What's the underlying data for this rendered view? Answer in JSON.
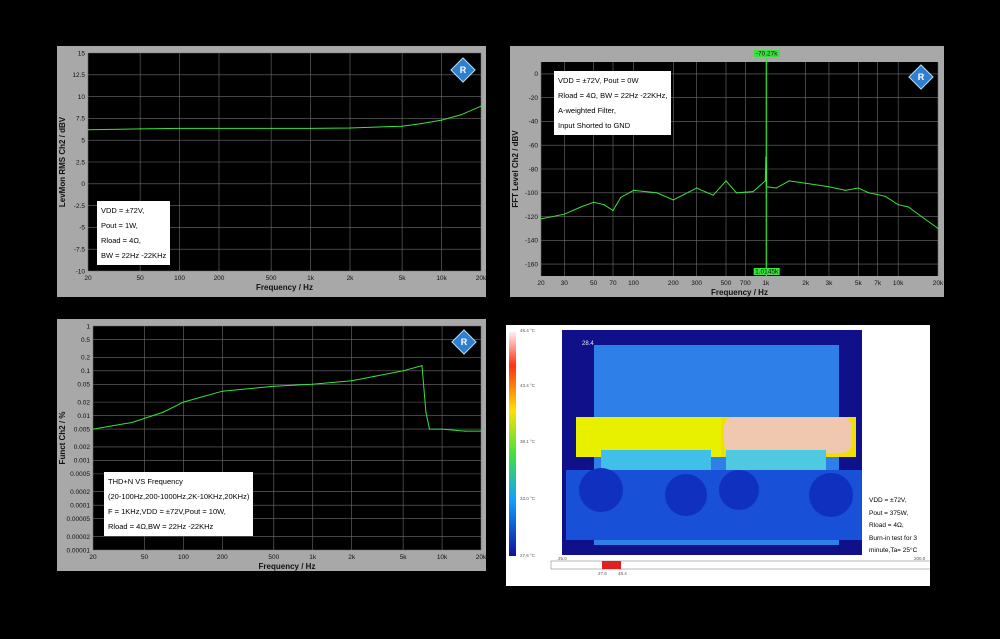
{
  "chart_data": [
    {
      "type": "line",
      "xlabel": "Frequency / Hz",
      "ylabel": "LevMon RMS Ch2 / dBV",
      "xscale": "log",
      "xlim": [
        20,
        20000
      ],
      "ylim": [
        -10,
        15
      ],
      "xticks": [
        "20",
        "50",
        "100",
        "200",
        "500",
        "1k",
        "2k",
        "5k",
        "10k",
        "20k"
      ],
      "yticks": [
        "15",
        "12.5",
        "10",
        "7.5",
        "5",
        "2.5",
        "0",
        "-2.5",
        "-5",
        "-7.5",
        "-10"
      ],
      "grid": true,
      "series": [
        {
          "x": [
            20,
            50,
            100,
            200,
            500,
            1000,
            2000,
            5000,
            7000,
            10000,
            14000,
            20000
          ],
          "y": [
            6.2,
            6.3,
            6.35,
            6.35,
            6.35,
            6.35,
            6.4,
            6.6,
            6.9,
            7.3,
            7.9,
            8.9
          ]
        }
      ],
      "annotation": [
        "VDD = ±72V,",
        "Pout = 1W,",
        "Rload = 4Ω,",
        "BW = 22Hz -22KHz"
      ]
    },
    {
      "type": "line",
      "xlabel": "Frequency / Hz",
      "ylabel": "FFT Level Ch2 / dBV",
      "xscale": "log",
      "xlim": [
        20,
        20000
      ],
      "ylim": [
        -170,
        10
      ],
      "xticks": [
        "20",
        "30",
        "50",
        "70",
        "100",
        "200",
        "300",
        "500",
        "700",
        "1k",
        "2k",
        "3k",
        "5k",
        "7k",
        "10k",
        "20k"
      ],
      "yticks": [
        "0",
        "-20",
        "-40",
        "-60",
        "-80",
        "-100",
        "-120",
        "-140",
        "-160"
      ],
      "grid": true,
      "cursor_labels": [
        "-70.27k",
        "1.0145k"
      ],
      "series": [
        {
          "x": [
            20,
            30,
            40,
            50,
            60,
            70,
            80,
            100,
            150,
            200,
            300,
            400,
            500,
            600,
            800,
            990,
            1000,
            1010,
            1200,
            1500,
            2000,
            3000,
            4000,
            5000,
            6000,
            8000,
            10000,
            12000,
            15000,
            20000
          ],
          "y": [
            -122,
            -118,
            -112,
            -108,
            -110,
            -115,
            -104,
            -98,
            -100,
            -106,
            -96,
            -102,
            -90,
            -100,
            -99,
            -90,
            -70,
            -95,
            -96,
            -90,
            -92,
            -95,
            -98,
            -96,
            -100,
            -103,
            -110,
            -112,
            -120,
            -130
          ]
        }
      ],
      "annotation": [
        "VDD = ±72V, Pout = 0W",
        "Rload = 4Ω, BW = 22Hz -22KHz,",
        "A-weighted Filter,",
        "Input Shorted to GND"
      ]
    },
    {
      "type": "line",
      "xlabel": "Frequency / Hz",
      "ylabel": "Funct Ch2 / %",
      "xscale": "log",
      "xlim": [
        20,
        20000
      ],
      "ylim": [
        1e-05,
        1
      ],
      "xticks": [
        "20",
        "50",
        "100",
        "200",
        "500",
        "1k",
        "2k",
        "5k",
        "10k",
        "20k"
      ],
      "yticks": [
        "1",
        "0.5",
        "0.2",
        "0.1",
        "0.05",
        "0.02",
        "0.01",
        "0.005",
        "0.002",
        "0.001",
        "0.0005",
        "0.0002",
        "0.0001",
        "0.00005",
        "0.00002",
        "0.00001"
      ],
      "grid": true,
      "series": [
        {
          "x": [
            20,
            40,
            70,
            100,
            200,
            500,
            1000,
            2000,
            3000,
            5000,
            7000,
            7500,
            8000,
            10000,
            15000,
            20000
          ],
          "y": [
            0.005,
            0.007,
            0.012,
            0.02,
            0.035,
            0.045,
            0.05,
            0.06,
            0.075,
            0.1,
            0.13,
            0.012,
            0.005,
            0.005,
            0.0045,
            0.0045
          ]
        }
      ],
      "annotation": [
        "THD+N VS  Frequency",
        "(20-100Hz,200-1000Hz,2K-10KHz,20KHz)",
        "F = 1KHz,VDD = ±72V,Pout = 10W,",
        "Rload = 4Ω,BW = 22Hz -22KHz"
      ]
    }
  ],
  "thermal": {
    "scale_labels": [
      "48.4 °C",
      "43.4 °C",
      "38.1 °C",
      "33.0 °C",
      "27.6 °C"
    ],
    "spot": "28.4",
    "bar_left": "25.0",
    "bar_right": "200.0",
    "bar_marks": [
      "27.6",
      "48.4"
    ],
    "notes": [
      "VDD = ±72V,",
      "Pout = 375W,",
      "Rload = 4Ω,",
      "Burn-in test for 3",
      "minute,Ta= 25°C"
    ]
  }
}
